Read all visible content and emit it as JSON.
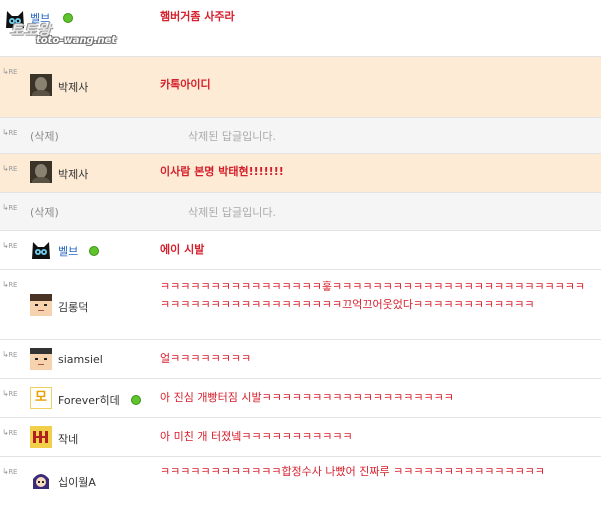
{
  "re_label": "RE",
  "top": {
    "nick": "벨브",
    "message": "햄버거좀 사주라"
  },
  "watermark": {
    "korean": "토토왕",
    "url": "toto-wang.net"
  },
  "rows": [
    {
      "nick": "박제사",
      "message": "카톡아이디"
    },
    {
      "nick": "(삭제)",
      "message": "삭제된 답글입니다."
    },
    {
      "nick": "박제사",
      "message": "이사람 본명 박태현!!!!!!!"
    },
    {
      "nick": "(삭제)",
      "message": "삭제된 답글입니다."
    },
    {
      "nick": "벨브",
      "message": "에이 시발"
    },
    {
      "nick": "김롱덕",
      "message": "ㅋㅋㅋㅋㅋㅋㅋㅋㅋㅋㅋㅋㅋㅋㅋㅋ흫ㅋㅋㅋㅋㅋㅋㅋㅋㅋㅋㅋㅋㅋㅋㅋㅋㅋㅋㅋㅋㅋㅋㅋㅋㅋㅋㅋㅋㅋㅋㅋㅋㅋㅋㅋㅋㅋㅋㅋㅋㅋㅋㅋ끄억끄어웃었다ㅋㅋㅋㅋㅋㅋㅋㅋㅋㅋㅋㅋ"
    },
    {
      "nick": "siamsiel",
      "message": "얼ㅋㅋㅋㅋㅋㅋㅋㅋ"
    },
    {
      "nick": "Forever히데",
      "avatar_char": "모",
      "message": "아 진심 개빵터짐 시발ㅋㅋㅋㅋㅋㅋㅋㅋㅋㅋㅋㅋㅋㅋㅋㅋㅋㅋㅋ"
    },
    {
      "nick": "작네",
      "message": "아 미친 개 터졌넼ㅋㅋㅋㅋㅋㅋㅋㅋㅋㅋㅋ"
    },
    {
      "nick": "십이월A",
      "message": "ㅋㅋㅋㅋㅋㅋㅋㅋㅋㅋㅋㅋ합정수사 나빴어 진짜루 ㅋㅋㅋㅋㅋㅋㅋㅋㅋㅋㅋㅋㅋㅋㅋ"
    }
  ],
  "colors": {
    "message": "#d61f2c",
    "nick_blue": "#2366c4",
    "highlight": "#fdebd5",
    "deleted": "#f5f5f5"
  }
}
